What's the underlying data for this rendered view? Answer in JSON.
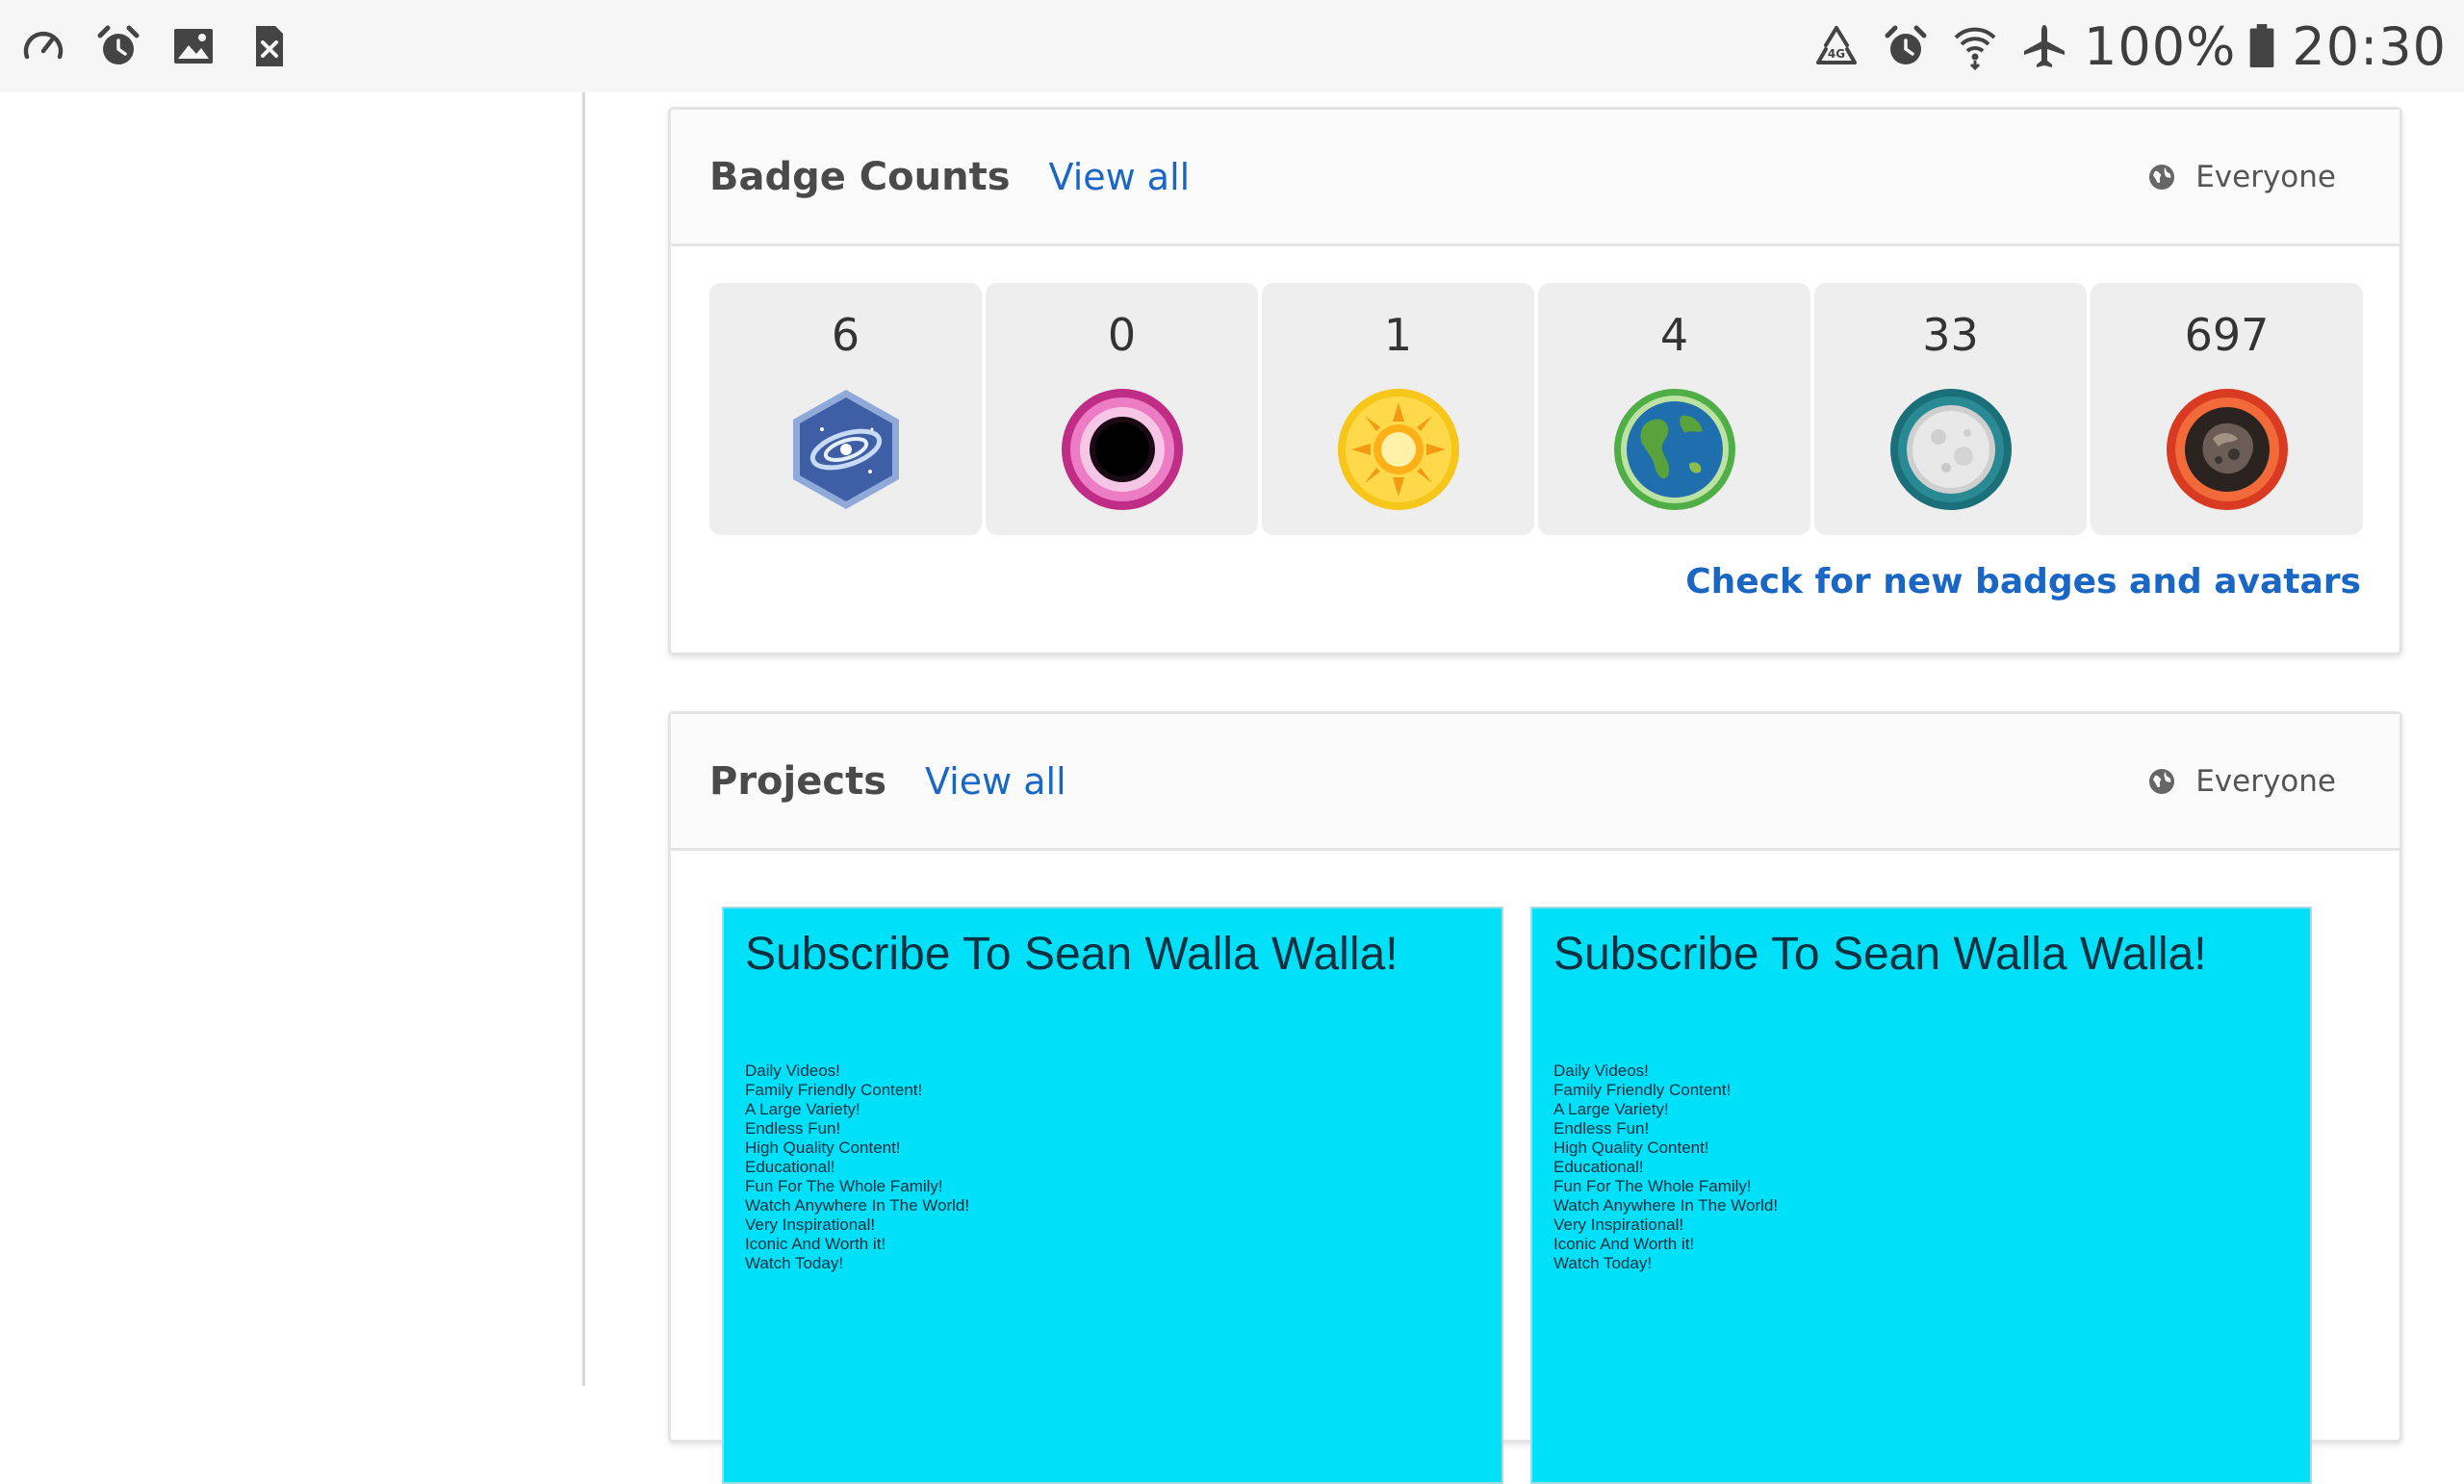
{
  "status_bar": {
    "left_icons": [
      "speedometer-icon",
      "alarm-icon",
      "image-icon",
      "sim-error-icon"
    ],
    "right_icons": [
      "recycle-icon",
      "alarm-icon",
      "wifi-icon",
      "airplane-icon"
    ],
    "battery_percent": "100%",
    "battery_level": 1.0,
    "time": "20:30"
  },
  "badge_card": {
    "title": "Badge Counts",
    "view_all": "View all",
    "privacy": "Everyone",
    "badges": [
      {
        "count": "6",
        "icon": "galaxy-hexagon-badge-icon",
        "colors": [
          "#4a6fb5",
          "#a8c4ee"
        ]
      },
      {
        "count": "0",
        "icon": "black-hole-badge-icon",
        "colors": [
          "#d43a9a",
          "#000000"
        ]
      },
      {
        "count": "1",
        "icon": "sun-badge-icon",
        "colors": [
          "#f5b400",
          "#ffd94a"
        ]
      },
      {
        "count": "4",
        "icon": "earth-badge-icon",
        "colors": [
          "#5cb54a",
          "#2a7ab8"
        ]
      },
      {
        "count": "33",
        "icon": "moon-badge-icon",
        "colors": [
          "#1e7d86",
          "#d9d9d9"
        ]
      },
      {
        "count": "697",
        "icon": "asteroid-badge-icon",
        "colors": [
          "#e24a2a",
          "#3a3330"
        ]
      }
    ],
    "check_link": "Check for new badges and avatars"
  },
  "projects_card": {
    "title": "Projects",
    "view_all": "View all",
    "privacy": "Everyone",
    "projects": [
      {
        "title": "Subscribe To Sean Walla Walla!",
        "lines": [
          "Daily Videos!",
          "Family Friendly Content!",
          "A Large Variety!",
          "Endless Fun!",
          "High Quality Content!",
          "Educational!",
          "Fun For The Whole Family!",
          "Watch Anywhere In The World!",
          "Very Inspirational!",
          "Iconic And Worth it!",
          "Watch Today!"
        ]
      },
      {
        "title": "Subscribe To Sean Walla Walla!",
        "lines": [
          "Daily Videos!",
          "Family Friendly Content!",
          "A Large Variety!",
          "Endless Fun!",
          "High Quality Content!",
          "Educational!",
          "Fun For The Whole Family!",
          "Watch Anywhere In The World!",
          "Very Inspirational!",
          "Iconic And Worth it!",
          "Watch Today!"
        ]
      }
    ]
  },
  "colors": {
    "link": "#1a66c5",
    "project_bg": "#00e0f8",
    "badge_cell_bg": "#eeeeee"
  }
}
